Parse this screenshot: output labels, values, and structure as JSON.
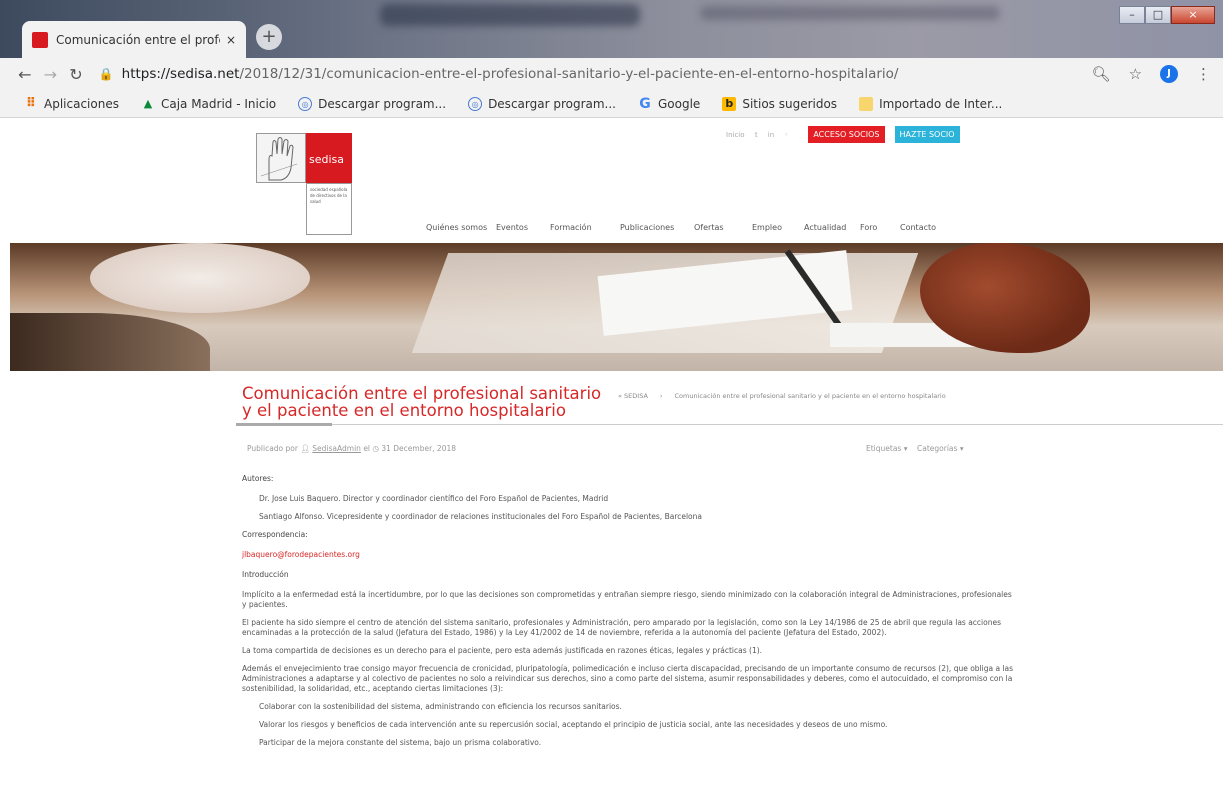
{
  "browser": {
    "tab_title": "Comunicación entre el profesion",
    "tab_close": "×",
    "new_tab": "+",
    "url_host": "https://sedisa.net",
    "url_path": "/2018/12/31/comunicacion-entre-el-profesional-sanitario-y-el-paciente-en-el-entorno-hospitalario/",
    "profile_initial": "J",
    "bookmarks": [
      {
        "label": "Aplicaciones",
        "icon": "apps-icon"
      },
      {
        "label": "Caja Madrid - Inicio",
        "icon": "caja-madrid-icon"
      },
      {
        "label": "Descargar program...",
        "icon": "download-site-icon"
      },
      {
        "label": "Descargar program...",
        "icon": "download-site-icon"
      },
      {
        "label": "Google",
        "icon": "google-icon"
      },
      {
        "label": "Sitios sugeridos",
        "icon": "bing-icon"
      },
      {
        "label": "Importado de Inter...",
        "icon": "folder-icon"
      }
    ]
  },
  "site": {
    "logo_text": "sedisa",
    "logo_subtext": "sociedad española de directivos de la salud",
    "top_links": [
      "Inicio"
    ],
    "btn_socios": "ACCESO SOCIOS",
    "btn_hazte": "HAZTE SOCIO",
    "nav": [
      "Quiénes somos",
      "Eventos",
      "Formación",
      "Publicaciones",
      "Ofertas",
      "Empleo",
      "Actualidad",
      "Foro",
      "Contacto"
    ]
  },
  "article": {
    "title": "Comunicación entre el profesional sanitario y el paciente en el entorno hospitalario",
    "breadcrumb_home": "« SEDISA",
    "breadcrumb_sep": "›",
    "breadcrumb_current": "Comunicación entre el profesional sanitario y el paciente en el entorno hospitalario",
    "meta_prefix": "Publicado por",
    "meta_author": "SedisaAdmin",
    "meta_mid": "el",
    "meta_date": "31 December, 2018",
    "meta_tags": "Etiquetas ▾",
    "meta_categories": "Categorías ▾",
    "authors_label": "Autores:",
    "author1": "Dr. Jose Luis Baquero. Director y coordinador científico del Foro Español de Pacientes, Madrid",
    "author2": "Santiago Alfonso. Vicepresidente y coordinador de relaciones institucionales del Foro Español de Pacientes, Barcelona",
    "correspondence_label": "Correspondencia:",
    "email": "jlbaquero@forodepacientes.org",
    "intro_label": "Introducción",
    "p1": "Implícito a la enfermedad está la incertidumbre, por lo que las decisiones son comprometidas y entrañan siempre riesgo, siendo minimizado con la colaboración integral de Administraciones, profesionales y pacientes.",
    "p2": "El paciente ha sido siempre el centro de atención del sistema sanitario, profesionales y Administración, pero amparado por la legislación, como son la Ley 14/1986 de 25 de abril que regula las acciones encaminadas a la protección de la salud (Jefatura del Estado, 1986) y la Ley 41/2002 de 14 de noviembre, referida a la autonomía del paciente (Jefatura del Estado, 2002).",
    "p3": "La toma compartida de decisiones es un derecho para el paciente, pero esta además justificada en razones éticas, legales y prácticas (1).",
    "p4": "Además el envejecimiento trae consigo mayor frecuencia de cronicidad, pluripatología, polimedicación e incluso cierta discapacidad, precisando de un importante consumo de recursos (2), que obliga a las Administraciones a adaptarse y al colectivo de pacientes no solo a reivindicar sus derechos, sino a como parte del sistema, asumir responsabilidades y deberes, como el autocuidado, el compromiso con la sostenibilidad, la solidaridad, etc., aceptando ciertas limitaciones (3):",
    "b1": "Colaborar con la sostenibilidad del sistema, administrando con eficiencia los recursos sanitarios.",
    "b2": "Valorar los riesgos y beneficios de cada intervención ante su repercusión social, aceptando el principio de justicia social, ante las necesidades y deseos de uno mismo.",
    "b3": "Participar de la mejora constante del sistema, bajo un prisma colaborativo."
  },
  "colors": {
    "brand_red": "#d71920",
    "title_red": "#d72828",
    "hazte_blue": "#2bb3d9"
  }
}
